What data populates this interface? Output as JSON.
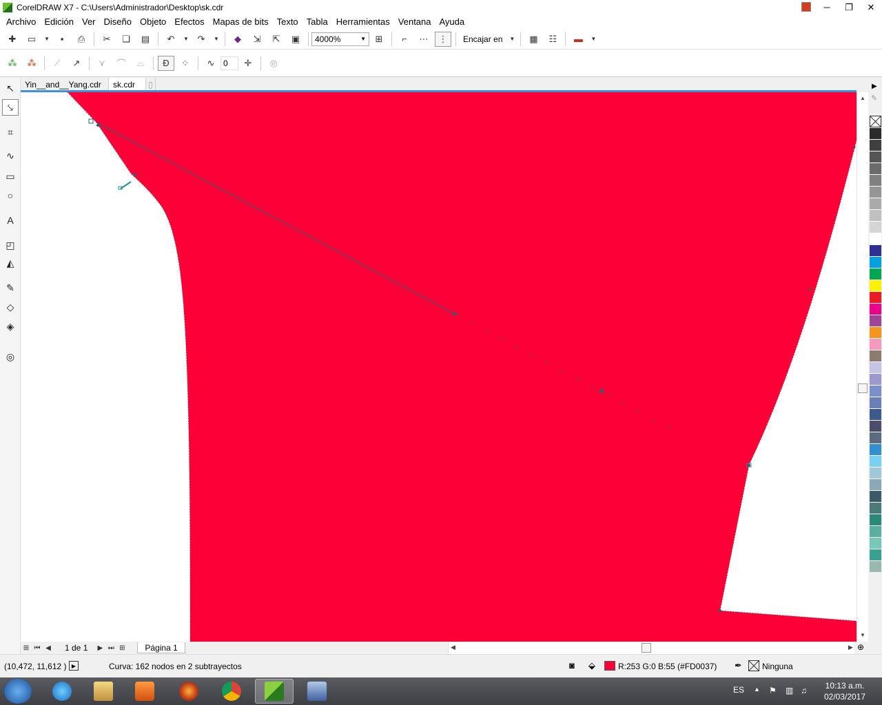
{
  "window": {
    "title": "CorelDRAW X7 - C:\\Users\\Administrador\\Desktop\\sk.cdr",
    "controls": [
      "─",
      "❐",
      "✕"
    ]
  },
  "menu": {
    "items": [
      "Archivo",
      "Edición",
      "Ver",
      "Diseño",
      "Objeto",
      "Efectos",
      "Mapas de bits",
      "Texto",
      "Tabla",
      "Herramientas",
      "Ventana",
      "Ayuda"
    ]
  },
  "toolbar": {
    "zoom_value": "4000%",
    "snap_label": "Encajar en"
  },
  "property_bar": {
    "smoothing_value": "0"
  },
  "tabs": [
    "Yin__and__Yang.cdr",
    "sk.cdr"
  ],
  "page_nav": {
    "page_of": "1 de 1",
    "page_tab": "Página 1"
  },
  "status": {
    "coords": "(10,472, 11,612 )",
    "object_info": "Curva: 162 nodos en 2 subtrayectos",
    "fill_info": "R:253 G:0 B:55 (#FD0037)",
    "outline_info": "Ninguna"
  },
  "taskbar": {
    "lang": "ES",
    "time": "10:13 a.m.",
    "date": "02/03/2017"
  },
  "colors": {
    "shape_fill": "#FD0037",
    "palette": [
      "#2b2b2b",
      "#404040",
      "#555555",
      "#6b6b6b",
      "#808080",
      "#959595",
      "#aaaaaa",
      "#c0c0c0",
      "#d5d5d5",
      "#ffffff",
      "#2e3192",
      "#00a0e3",
      "#00a651",
      "#fff200",
      "#ed1c24",
      "#ec008c",
      "#a0449a",
      "#f7941d",
      "#f49ac1",
      "#8c7b70",
      "#c4c4e4",
      "#9a9ad0",
      "#7b8fc8",
      "#6a7fb8",
      "#3d5a8c",
      "#4c4c6c",
      "#5a6a80",
      "#2f8fd0",
      "#7ad0f0",
      "#a0c8d8",
      "#8aa8b8",
      "#3a5a6a",
      "#4a7a7a",
      "#2a8a7a",
      "#5ab0a0",
      "#78c8b8",
      "#3aa090",
      "#98b8b0"
    ]
  }
}
